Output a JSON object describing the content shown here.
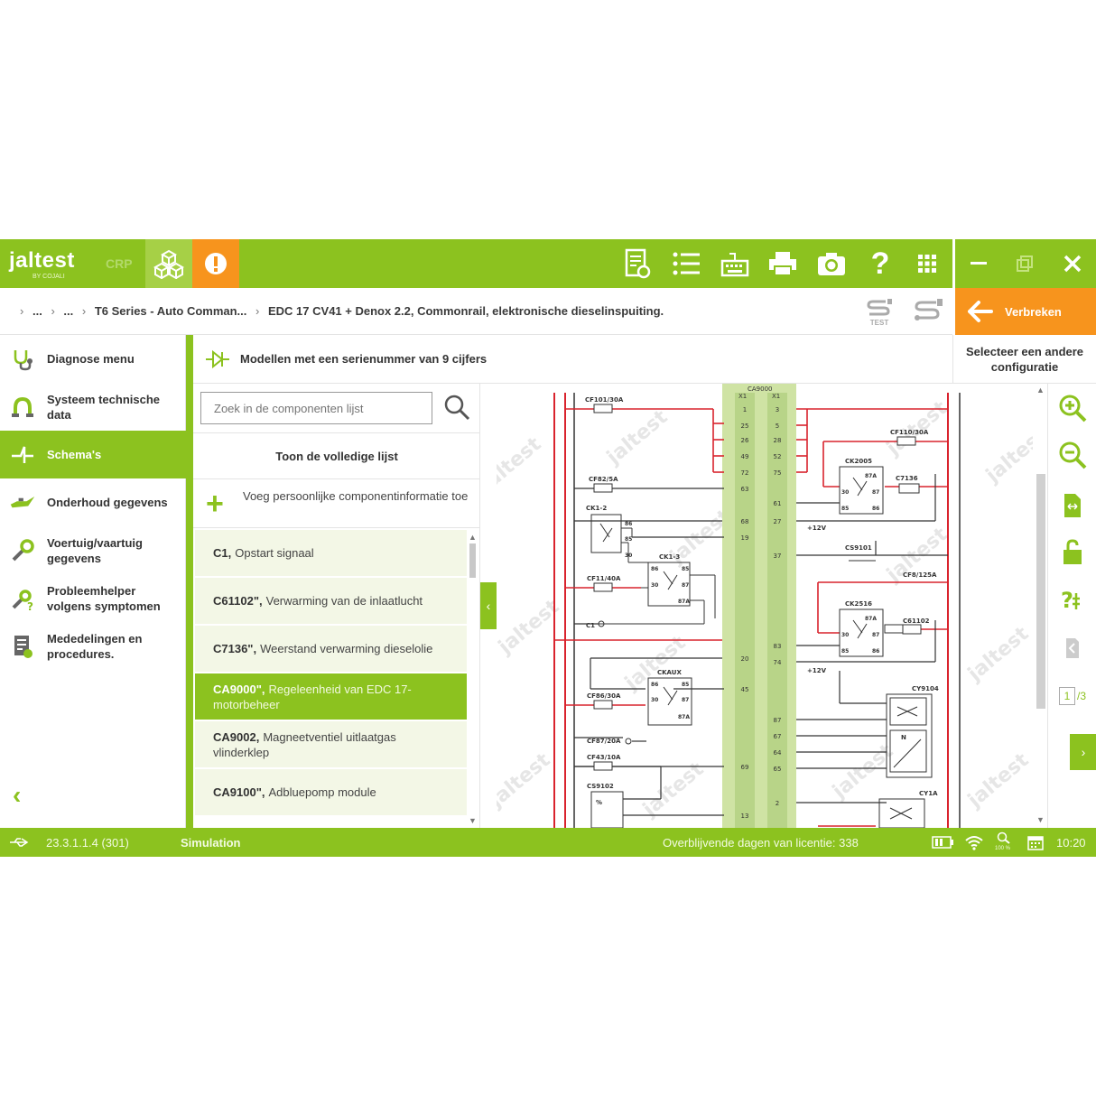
{
  "app": {
    "logo_text": "jaltest",
    "logo_sub": "BY COJALI",
    "mode_label": "CRP"
  },
  "breadcrumb": {
    "items": [
      "...",
      "...",
      "T6 Series - Auto Comman...",
      "EDC 17 CV41 + Denox 2.2, Commonrail, elektronische dieselinspuiting."
    ],
    "s_test_label": "TEST"
  },
  "disconnect": {
    "label": "Verbreken"
  },
  "other_config": {
    "label": "Selecteer een andere configuratie"
  },
  "sidebar": {
    "items": [
      {
        "label": "Diagnose menu",
        "active": false
      },
      {
        "label": "Systeem technische data",
        "active": false
      },
      {
        "label": "Schema's",
        "active": true
      },
      {
        "label": "Onderhoud gegevens",
        "active": false
      },
      {
        "label": "Voertuig/vaartuig gegevens",
        "active": false
      },
      {
        "label": "Probleemhelper volgens symptomen",
        "active": false
      },
      {
        "label": "Mededelingen en procedures.",
        "active": false
      }
    ]
  },
  "content": {
    "title": "Modellen met een serienummer van 9 cijfers"
  },
  "list": {
    "search_placeholder": "Zoek in de componenten lijst",
    "full_list_label": "Toon de volledige lijst",
    "add_info_label": "Voeg persoonlijke componentinformatie toe",
    "components": [
      {
        "code": "C1,",
        "desc": "Opstart signaal",
        "selected": false
      },
      {
        "code": "C61102\",",
        "desc": "Verwarming van de inlaatlucht",
        "selected": false
      },
      {
        "code": "C7136\",",
        "desc": "Weerstand verwarming dieselolie",
        "selected": false
      },
      {
        "code": "CA9000\",",
        "desc": "Regeleenheid van EDC 17-motorbeheer",
        "selected": true
      },
      {
        "code": "CA9002,",
        "desc": "Magneetventiel uitlaatgas vlinderklep",
        "selected": false
      },
      {
        "code": "CA9100\",",
        "desc": "Adbluepomp module",
        "selected": false
      }
    ]
  },
  "schematic": {
    "watermark": "jaltest",
    "connector_title": "CA9000",
    "connector_left_label": "X1",
    "connector_right_label": "X1",
    "left_pins": [
      "1",
      "25",
      "26",
      "49",
      "72",
      "63",
      "68",
      "19",
      "20",
      "45",
      "69",
      "13"
    ],
    "right_pins": [
      "3",
      "5",
      "28",
      "52",
      "75",
      "61",
      "27",
      "37",
      "83",
      "74",
      "87",
      "67",
      "64",
      "65",
      "2"
    ],
    "labels": {
      "cf101": "CF101/30A",
      "cf82": "CF82/5A",
      "ck1_2": "CK1-2",
      "ck1_3": "CK1-3",
      "cf11": "CF11/40A",
      "c1": "C1",
      "ckaux": "CKAUX",
      "cf86": "CF86/30A",
      "cf87": "CF87/20A",
      "cf43": "CF43/10A",
      "cs9102": "CS9102",
      "cf110": "CF110/30A",
      "ck2005": "CK2005",
      "c7136": "C7136",
      "cs9101": "CS9101",
      "cf8": "CF8/125A",
      "ck2516": "CK2516",
      "c61102": "C61102",
      "cy9104": "CY9104",
      "cy1a": "CY1A",
      "plus12v_a": "+12V",
      "plus12v_b": "+12V",
      "percent": "%",
      "n_label": "N"
    },
    "relay_pins": {
      "p86": "86",
      "p85": "85",
      "p30": "30",
      "p87": "87",
      "p87a": "87A"
    }
  },
  "pages": {
    "current": "1",
    "total": "/3"
  },
  "status": {
    "version": "23.3.1.1.4 (301)",
    "mode": "Simulation",
    "license": "Overblijvende dagen van licentie: 338",
    "zoom": "100 %",
    "time": "10:20"
  },
  "colors": {
    "brand_green": "#8cc21f",
    "accent_orange": "#f7941d",
    "wire_red": "#d9232d",
    "connector_green": "#cfe3a4"
  }
}
